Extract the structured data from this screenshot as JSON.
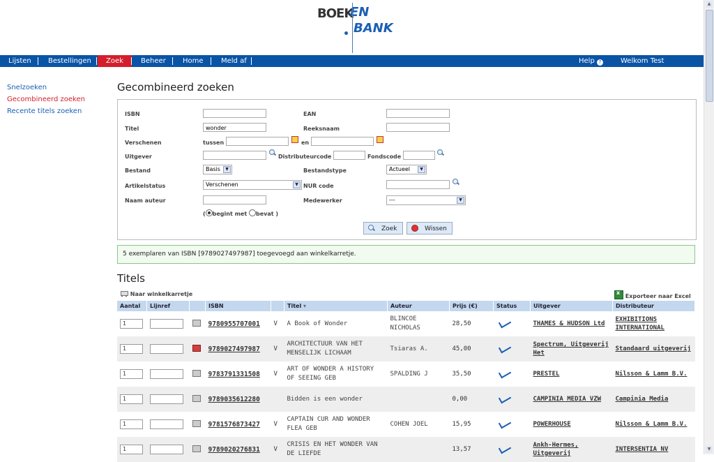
{
  "logo": {
    "word1": "BOEK",
    "word2": "EN",
    "word3": "BANK"
  },
  "nav": {
    "items": [
      "Lijsten",
      "Bestellingen",
      "Zoek",
      "Beheer",
      "Home",
      "Meld af"
    ],
    "help": "Help",
    "welcome": "Welkom Test bibliotheek"
  },
  "sidebar": [
    "Snelzoeken",
    "Gecombineerd zoeken",
    "Recente titels zoeken"
  ],
  "page_title": "Gecombineerd zoeken",
  "form": {
    "isbn_label": "ISBN",
    "isbn_value": "",
    "ean_label": "EAN",
    "ean_value": "",
    "titel_label": "Titel",
    "titel_value": "wonder",
    "reeksnaam_label": "Reeksnaam",
    "reeksnaam_value": "",
    "verschenen_label": "Verschenen",
    "tussen_label": "tussen",
    "en_label": "en",
    "uitgever_label": "Uitgever",
    "distributeurcode_label": "Distributeurcode",
    "fondscode_label": "Fondscode",
    "bestand_label": "Bestand",
    "bestand_value": "Basis",
    "bestandstype_label": "Bestandstype",
    "bestandstype_value": "Actueel",
    "artikelstatus_label": "Artikelstatus",
    "artikelstatus_value": "Verschenen",
    "nurcode_label": "NUR code",
    "naamauteur_label": "Naam auteur",
    "medewerker_label": "Medewerker",
    "medewerker_value": "---",
    "radio_open": "(",
    "radio_begint": "begint met",
    "radio_bevat": "bevat",
    "radio_close": ")",
    "zoek_button": "Zoek",
    "wissen_button": "Wissen"
  },
  "message": "5 exemplaren van ISBN [9789027497987] toegevoegd aan winkelkarretje.",
  "results_title": "Titels",
  "toolbar": {
    "cart_link": "Naar winkelkarretje",
    "export_link": "Exporteer naar Excel"
  },
  "table": {
    "headers": [
      "Aantal",
      "Lijnref",
      "ISBN",
      "Titel",
      "Auteur",
      "Prijs (€)",
      "Status",
      "Uitgever",
      "Distributeur"
    ],
    "rows": [
      {
        "qty": "1",
        "isbn": "9780955707001",
        "v": "V",
        "title": "A Book of Wonder",
        "author": "BLINCOE NICHOLAS",
        "price": "28,50",
        "publisher": "THAMES & HUDSON Ltd",
        "distributor": "EXHIBITIONS INTERNATIONAL",
        "cart": "gray"
      },
      {
        "qty": "1",
        "isbn": "9789027497987",
        "v": "V",
        "title": "ARCHITECTUUR VAN HET MENSELIJK LICHAAM",
        "author": "Tsiaras A.",
        "price": "45,00",
        "publisher": "Spectrum, Uitgeverij Het",
        "distributor": "Standaard uitgeverij",
        "cart": "red"
      },
      {
        "qty": "1",
        "isbn": "9783791331508",
        "v": "V",
        "title": "ART OF WONDER A HISTORY OF SEEING GEB",
        "author": "SPALDING J",
        "price": "35,50",
        "publisher": "PRESTEL",
        "distributor": "Nilsson & Lamm B.V.",
        "cart": "gray"
      },
      {
        "qty": "1",
        "isbn": "9789035612280",
        "v": "",
        "title": "Bidden is een wonder",
        "author": "",
        "price": "0,00",
        "publisher": "CAMPINIA MEDIA VZW",
        "distributor": "Campinia Media",
        "cart": "gray"
      },
      {
        "qty": "1",
        "isbn": "9781576873427",
        "v": "V",
        "title": "CAPTAIN CUR AND WONDER FLEA GEB",
        "author": "COHEN JOEL",
        "price": "15,95",
        "publisher": "POWERHOUSE",
        "distributor": "Nilsson & Lamm B.V.",
        "cart": "gray"
      },
      {
        "qty": "1",
        "isbn": "9789020276831",
        "v": "V",
        "title": "CRISIS EN HET WONDER VAN DE LIEFDE",
        "author": "",
        "price": "13,57",
        "publisher": "Ankh-Hermes, Uitgeverij",
        "distributor": "INTERSENTIA NV",
        "cart": "gray"
      }
    ]
  }
}
